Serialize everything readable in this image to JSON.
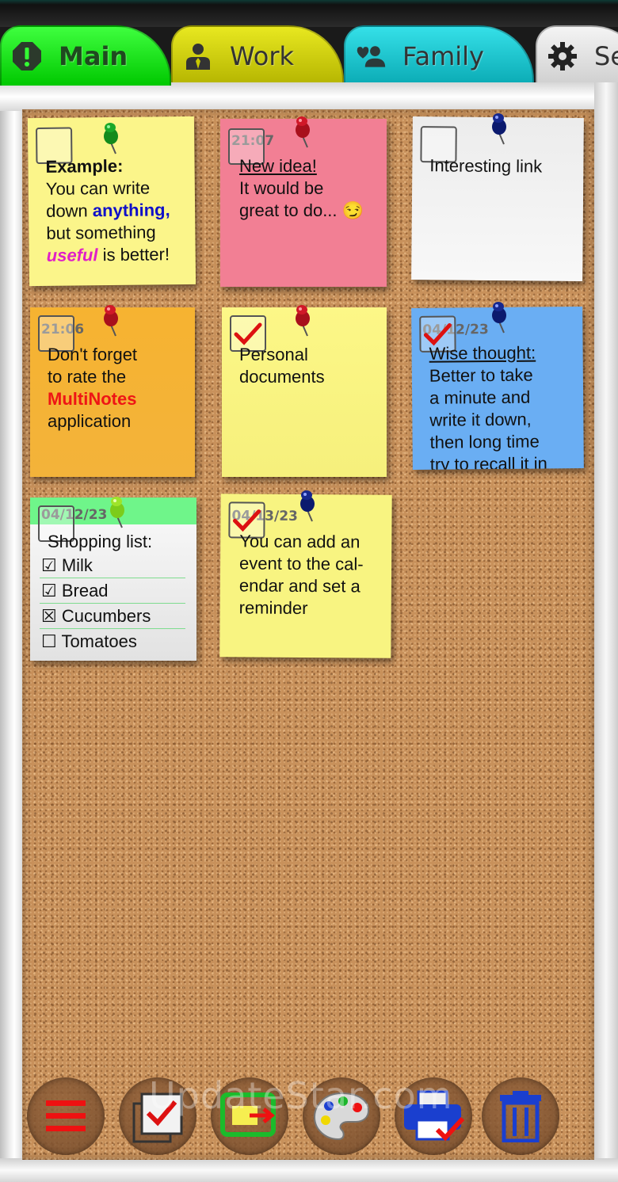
{
  "tabs": [
    {
      "label": "Main",
      "icon": "exclamation-icon",
      "color": "#00d000"
    },
    {
      "label": "Work",
      "icon": "person-icon",
      "color": "#c8c800"
    },
    {
      "label": "Family",
      "icon": "people-icon",
      "color": "#1cc6d0"
    },
    {
      "label": "Se",
      "icon": "gear-icon",
      "color": "#e0e0e0"
    }
  ],
  "notes": {
    "example": {
      "line1": "Example:",
      "line2": "You can write",
      "line3a": "down ",
      "line3b": "anything,",
      "line4": "but something",
      "line5a": "useful",
      "line5b": " is better!",
      "color": "#fbf58a"
    },
    "idea": {
      "date": "21:07",
      "line1": "New idea!",
      "line2": "It would be",
      "line3": "great to do... 😏",
      "color": "#f27f94"
    },
    "link": {
      "line1": "Interesting link",
      "color": "#eeeeee"
    },
    "rate": {
      "date": "21:06",
      "line1": "Don't forget",
      "line2": "to rate the",
      "line3": "MultiNotes",
      "line4": "application",
      "color": "#f6b331"
    },
    "documents": {
      "line1": "Personal",
      "line2": "documents",
      "color": "#fcf787"
    },
    "thought": {
      "date": "04/12/23",
      "line1": "Wise thought:",
      "line2": "Better to take",
      "line3": "a minute and",
      "line4": "write it down,",
      "line5": "then long time",
      "line6": "try to recall it in",
      "color": "#6aaef3"
    },
    "shopping": {
      "date": "04/12/23",
      "title": "Shopping list:",
      "items": [
        "☑ Milk",
        "☑ Bread",
        "☒ Cucumbers",
        "☐ Tomatoes"
      ],
      "color": "#fafafa",
      "header_color": "#6ff58a"
    },
    "event": {
      "date": "04/13/23",
      "line1": "You can add an",
      "line2": "event to the cal-",
      "line3": "endar and set a",
      "line4": "reminder",
      "color": "#f8f481"
    }
  },
  "toolbar": {
    "buttons": [
      "menu-icon",
      "select-notes-icon",
      "move-note-icon",
      "palette-icon",
      "print-icon",
      "trash-icon"
    ]
  },
  "watermark": "UpdateStar.com"
}
